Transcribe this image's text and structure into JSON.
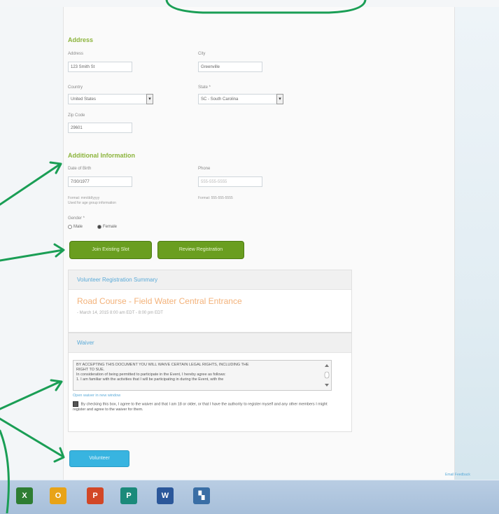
{
  "address": {
    "section_title": "Address",
    "address_label": "Address",
    "address_value": "123 Smith St",
    "city_label": "City",
    "city_value": "Greenville",
    "country_label": "Country",
    "country_value": "United States",
    "state_label": "State *",
    "state_value": "SC - South Carolina",
    "zip_label": "Zip Code",
    "zip_value": "29601"
  },
  "additional": {
    "section_title": "Additional Information",
    "dob_label": "Date of Birth",
    "dob_value": "7/30/1977",
    "dob_hint": "Format: mm/dd/yyyy",
    "dob_hint2": "Used for age group information",
    "phone_label": "Phone",
    "phone_placeholder": "555-555-5555",
    "phone_hint": "Format: 555-555-5555",
    "gender_label": "Gender *",
    "gender_options": [
      "Male",
      "Female"
    ],
    "gender_selected": "Female"
  },
  "buttons": {
    "join": "Join Existing Slot",
    "review": "Review Registration",
    "volunteer": "Volunteer"
  },
  "summary": {
    "title": "Volunteer Registration Summary",
    "event_title": "Road Course - Field Water Central Entrance",
    "event_time": "- March 14, 2015 8:00 am EDT - 8:00 pm EDT"
  },
  "waiver": {
    "title": "Waiver",
    "text_line1": "BY ACCEPTING THIS DOCUMENT YOU WILL WAIVE CERTAIN LEGAL RIGHTS, INCLUDING THE",
    "text_line2": "RIGHT TO SUE.",
    "text_line3": "In consideration of being permitted to participate in the Event, I hereby agree as follows:",
    "text_line4": "1.    I am familiar with the activities that I will be participating in during the Event, with the",
    "open_link": "Open waiver in new window",
    "agree_text": "By checking this box, I agree to the waiver and that I am 18 or older, or that I have the authority to register myself and any other members I might register and agree to the waiver for them."
  },
  "footer": {
    "link": "Email Feedback"
  },
  "taskbar": {
    "icons": [
      "excel-icon",
      "outlook-icon",
      "powerpoint-icon",
      "publisher-icon",
      "word-icon",
      "network-icon"
    ],
    "letters": [
      "X",
      "O",
      "P",
      "P",
      "W",
      "▚"
    ],
    "colors": [
      "#2e7d32",
      "#e8a317",
      "#d24726",
      "#1b8a7a",
      "#2b579a",
      "#3a6ea5"
    ]
  },
  "annotation_color": "#1a9e55"
}
